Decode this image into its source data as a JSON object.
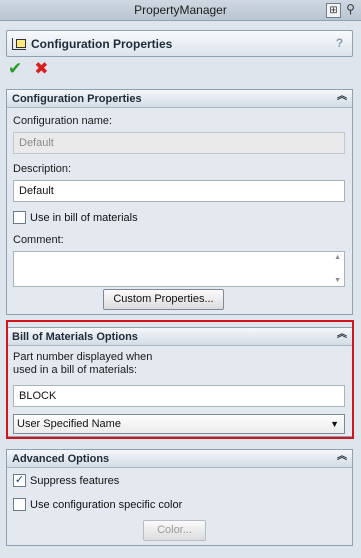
{
  "window": {
    "title": "PropertyManager",
    "pin_glyph": "☩",
    "push_glyph": "✕",
    "icons": [
      "pushpin-icon",
      "close-panel-icon"
    ]
  },
  "header": {
    "title": "Configuration Properties",
    "help_label": "?",
    "icon": "configuration-icon"
  },
  "actions": {
    "ok_glyph": "✔",
    "cancel_glyph": "✖"
  },
  "config_panel": {
    "title": "Configuration Properties",
    "name_label": "Configuration name:",
    "name_value": "Default",
    "description_label": "Description:",
    "description_value": "Default",
    "use_in_bom_label": "Use in bill of materials",
    "use_in_bom_checked": false,
    "comment_label": "Comment:",
    "comment_value": "",
    "custom_properties_label": "Custom Properties...",
    "collapse_glyph": "⌃"
  },
  "bom_panel": {
    "title": "Bill of Materials Options",
    "part_number_label_line1": "Part number displayed when",
    "part_number_label_line2": "used in a bill of materials:",
    "part_number_value": "BLOCK",
    "name_option_selected": "User Specified Name",
    "collapse_glyph": "⌃"
  },
  "advanced_panel": {
    "title": "Advanced Options",
    "suppress_label": "Suppress features",
    "suppress_checked": true,
    "specific_color_label": "Use configuration specific color",
    "specific_color_checked": false,
    "color_button_label": "Color...",
    "collapse_glyph": "⌃"
  },
  "colors": {
    "highlight": "#d0151c",
    "ok": "#2a9a2a",
    "cancel": "#d81e1e"
  }
}
